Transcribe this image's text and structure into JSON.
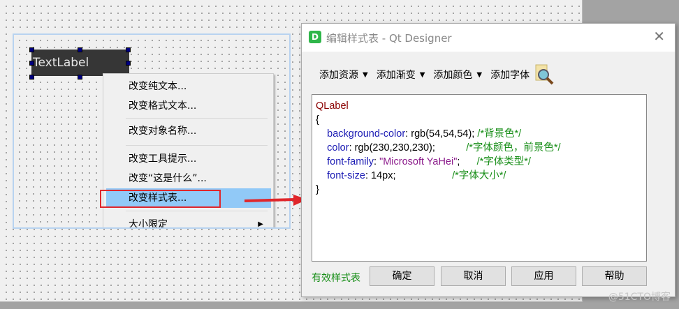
{
  "designer": {
    "label_text": "TextLabel"
  },
  "context_menu": {
    "items": [
      "改变纯文本...",
      "改变格式文本...",
      "改变对象名称...",
      "改变工具提示...",
      "改变“这是什么”...",
      "改变样式表...",
      "大小限定"
    ]
  },
  "dialog": {
    "title": "编辑样式表 - Qt Designer",
    "app_icon": "D",
    "toolbar": {
      "add_resource": "添加资源",
      "add_gradient": "添加渐变",
      "add_color": "添加颜色",
      "add_font": "添加字体"
    },
    "code": {
      "selector": "QLabel",
      "open": "{",
      "close": "}",
      "lines": [
        {
          "prop": "background-color",
          "value": "rgb(54,54,54);",
          "comment": "/*背景色*/"
        },
        {
          "prop": "color",
          "value": "rgb(230,230,230);",
          "comment": "/*字体颜色，前景色*/"
        },
        {
          "prop": "font-family",
          "value": "\"Microsoft YaHei\"",
          "comment": "/*字体类型*/"
        },
        {
          "prop": "font-size",
          "value": "14px;",
          "comment": "/*字体大小*/"
        }
      ]
    },
    "status": "有效样式表",
    "buttons": {
      "ok": "确定",
      "cancel": "取消",
      "apply": "应用",
      "help": "帮助"
    }
  },
  "watermark": "@51CTO博客",
  "colors": {
    "label_bg": "#363636",
    "highlight": "#91c9f7",
    "annotation": "#e0262b",
    "valid": "#1a8f1a"
  }
}
